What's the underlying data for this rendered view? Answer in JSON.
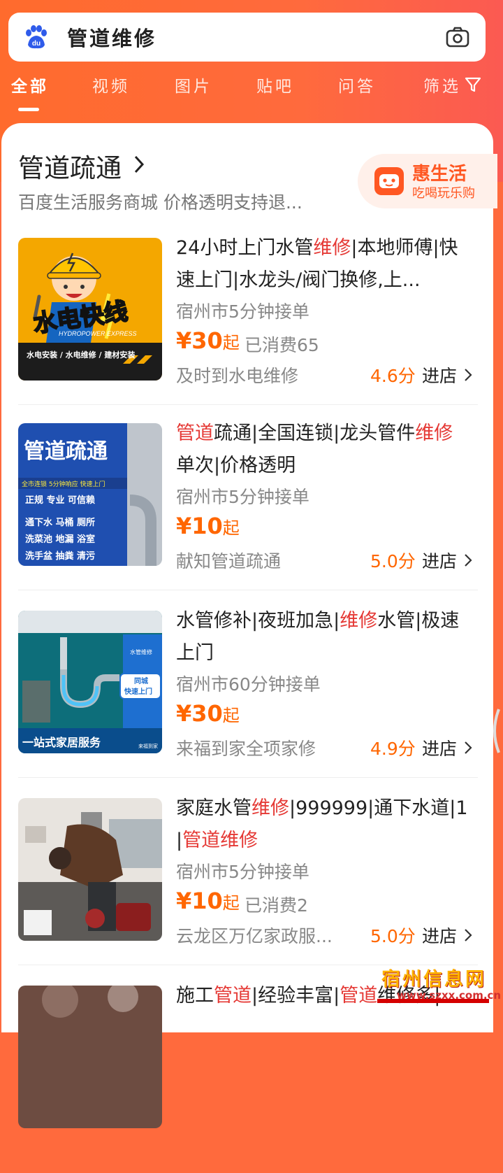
{
  "search": {
    "query": "管道维修"
  },
  "tabs": [
    {
      "label": "全部"
    },
    {
      "label": "视频"
    },
    {
      "label": "图片"
    },
    {
      "label": "贴吧"
    },
    {
      "label": "问答"
    },
    {
      "label": "筛选"
    }
  ],
  "section": {
    "title": "管道疏通",
    "subtitle": "百度生活服务商城 价格透明支持退...",
    "promo": {
      "title": "惠生活",
      "subtitle": "吃喝玩乐购"
    }
  },
  "thumbs": {
    "t1": {
      "name": "水电快线",
      "en": "HYDROPOWER EXPRESS",
      "foot": "水电安装 / 水电维修 / 建材安装"
    },
    "t2": {
      "name": "管道疏通",
      "chips": "全市连锁  5分钟响应  快速上门",
      "row1": "正规   专业   可信赖",
      "row2": "通下水  马桶  厕所",
      "row3": "洗菜池  地漏  浴室",
      "row4": "洗手盆  抽粪  清污"
    },
    "t3": {
      "tag": "水管维修",
      "badge1": "同城",
      "badge2": "快速上门",
      "foot": "一站式家居服务",
      "brand": "来福到家"
    }
  },
  "items": [
    {
      "title_parts": [
        {
          "t": "24小时上门水管",
          "hl": false
        },
        {
          "t": "维修",
          "hl": true
        },
        {
          "t": "|本地师傅|快速上门|水龙头/阀门换修,上...",
          "hl": false
        }
      ],
      "location": "宿州市5分钟接单",
      "price": "¥30",
      "price_suffix": "起",
      "sold": "已消费65",
      "shop": "及时到水电维修",
      "rating": "4.6分",
      "enter": "进店"
    },
    {
      "title_parts": [
        {
          "t": "管道",
          "hl": true
        },
        {
          "t": "疏通|全国连锁|龙头管件",
          "hl": false
        },
        {
          "t": "维修",
          "hl": true
        },
        {
          "t": " 单次|价格透明",
          "hl": false
        }
      ],
      "location": "宿州市5分钟接单",
      "price": "¥10",
      "price_suffix": "起",
      "sold": "",
      "shop": "献知管道疏通",
      "rating": "5.0分",
      "enter": "进店"
    },
    {
      "title_parts": [
        {
          "t": "水管修补|夜班加急|",
          "hl": false
        },
        {
          "t": "维修",
          "hl": true
        },
        {
          "t": "水管|极速上门",
          "hl": false
        }
      ],
      "location": "宿州市60分钟接单",
      "price": "¥30",
      "price_suffix": "起",
      "sold": "",
      "shop": "来福到家全项家修",
      "rating": "4.9分",
      "enter": "进店"
    },
    {
      "title_parts": [
        {
          "t": "家庭水管",
          "hl": false
        },
        {
          "t": "维修",
          "hl": true
        },
        {
          "t": "|999999|通下水道|1|",
          "hl": false
        },
        {
          "t": "管道维修",
          "hl": true
        }
      ],
      "location": "宿州市5分钟接单",
      "price": "¥10",
      "price_suffix": "起",
      "sold": "已消费2",
      "shop": "云龙区万亿家政服...",
      "rating": "5.0分",
      "enter": "进店"
    },
    {
      "title_parts": [
        {
          "t": "施工",
          "hl": false
        },
        {
          "t": "管道",
          "hl": true
        },
        {
          "t": "|经验丰富|",
          "hl": false
        },
        {
          "t": "管道",
          "hl": true
        },
        {
          "t": "维修多|...",
          "hl": false
        }
      ],
      "location": "",
      "price": "",
      "price_suffix": "",
      "sold": "",
      "shop": "",
      "rating": "",
      "enter": ""
    }
  ],
  "watermark": {
    "title": "宿州信息网",
    "url": "www.szxx.com.cn"
  },
  "colors": {
    "accent": "#ff6a3d",
    "highlight": "#e53935",
    "price": "#ff6600"
  }
}
